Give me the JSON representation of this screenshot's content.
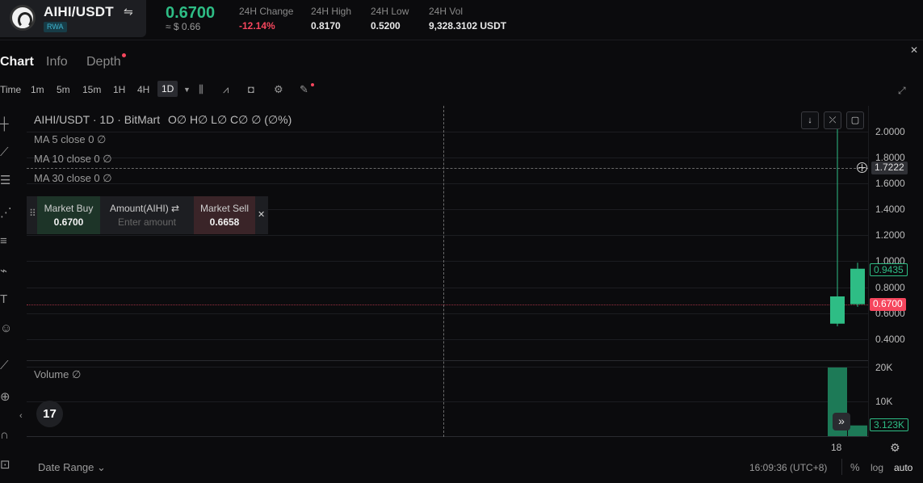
{
  "header": {
    "pair": "AIHI/USDT",
    "badge": "RWA",
    "last_price": "0.6700",
    "usd_price": "≈ $ 0.66",
    "stats": [
      {
        "label": "24H Change",
        "value": "-12.14%",
        "color": "#f6465d"
      },
      {
        "label": "24H High",
        "value": "0.8170"
      },
      {
        "label": "24H Low",
        "value": "0.5200"
      },
      {
        "label": "24H Vol",
        "value": "9,328.3102 USDT"
      }
    ]
  },
  "tabs": {
    "chart": "Chart",
    "info": "Info",
    "depth": "Depth"
  },
  "toolbar": {
    "timeframes": [
      "Time",
      "1m",
      "5m",
      "15m",
      "1H",
      "4H",
      "1D"
    ],
    "active": "1D",
    "icons": [
      "chevron-down-icon",
      "candle-type-icon",
      "indicators-icon",
      "camera-icon",
      "gear-icon",
      "pencil-icon"
    ]
  },
  "chart": {
    "legend_title": "AIHI/USDT · 1D · BitMart",
    "ohlc": "O∅ H∅ L∅ C∅ ∅ (∅%)",
    "ma": [
      "MA 5 close 0 ∅",
      "MA 10 close 0 ∅",
      "MA 30 close 0 ∅"
    ],
    "y_ticks": [
      "2.0000",
      "1.8000",
      "1.6000",
      "1.4000",
      "1.2000",
      "1.0000",
      "0.8000",
      "0.6000",
      "0.4000"
    ],
    "crosshair_price": "1.7222",
    "close_tag": "0.9435",
    "last_tag": "0.6700",
    "volume_label": "Volume ∅",
    "vol_ticks": [
      "20K",
      "10K"
    ],
    "vol_tag": "3.123K",
    "x_label": "18",
    "colors": {
      "up": "#2ebd85",
      "down": "#f6465d"
    }
  },
  "chart_data": {
    "type": "candlestick",
    "ylim": [
      0.3,
      2.1
    ],
    "candles": [
      {
        "x": "17",
        "open": 0.52,
        "high": 2.05,
        "low": 0.5,
        "close": 0.73,
        "volume": 20000
      },
      {
        "x": "18",
        "open": 0.67,
        "high": 0.99,
        "low": 0.65,
        "close": 0.9435,
        "volume": 3123
      }
    ],
    "y_ticks": [
      2.0,
      1.8,
      1.6,
      1.4,
      1.2,
      1.0,
      0.8,
      0.6,
      0.4
    ],
    "vol_ticks": [
      "20K",
      "10K"
    ],
    "vol_max": 20000
  },
  "trade_panel": {
    "buy_label": "Market Buy",
    "buy_price": "0.6700",
    "amount_label": "Amount(AIHI) ⇄",
    "amount_placeholder": "Enter amount",
    "sell_label": "Market Sell",
    "sell_price": "0.6658"
  },
  "footer": {
    "date_range": "Date Range ⌄",
    "time": "16:09:36 (UTC+8)",
    "pct": "%",
    "log": "log",
    "auto": "auto"
  }
}
